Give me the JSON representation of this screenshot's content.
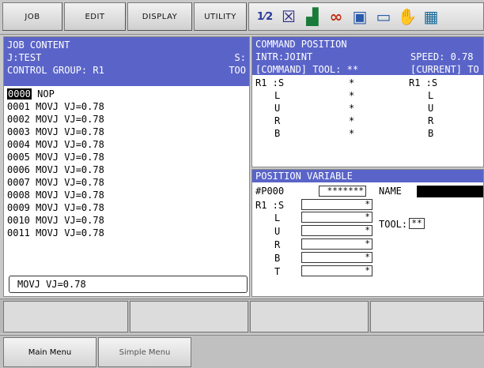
{
  "menu": {
    "job": "JOB",
    "edit": "EDIT",
    "display": "DISPLAY",
    "utility": "UTILITY"
  },
  "toolbar_icons": [
    {
      "name": "teach-mode-icon",
      "glyph": "1⁄2",
      "color": "#2a3a9a"
    },
    {
      "name": "edit-check-icon",
      "glyph": "☒",
      "color": "#2a2a8a"
    },
    {
      "name": "chart-icon",
      "glyph": "▟",
      "color": "#1a7a3a"
    },
    {
      "name": "link-icon",
      "glyph": "∞",
      "color": "#c0301a"
    },
    {
      "name": "memory-icon",
      "glyph": "▣",
      "color": "#2a5aaa"
    },
    {
      "name": "screen-icon",
      "glyph": "▭",
      "color": "#2a5aaa"
    },
    {
      "name": "hand-icon",
      "glyph": "✋",
      "color": "#d09000"
    },
    {
      "name": "grid-icon",
      "glyph": "▦",
      "color": "#1a6a9a"
    }
  ],
  "job_content": {
    "title": "JOB CONTENT",
    "job_name": "J:TEST",
    "step_label": "S:",
    "control_group": "CONTROL GROUP: R1",
    "tool_label": "TOO",
    "highlight_line_no": "0000",
    "highlight_line_text": "NOP",
    "lines": [
      "0001 MOVJ VJ=0.78",
      "0002 MOVJ VJ=0.78",
      "0003 MOVJ VJ=0.78",
      "0004 MOVJ VJ=0.78",
      "0005 MOVJ VJ=0.78",
      "0006 MOVJ VJ=0.78",
      "0007 MOVJ VJ=0.78",
      "0008 MOVJ VJ=0.78",
      "0009 MOVJ VJ=0.78",
      "0010 MOVJ VJ=0.78",
      "0011 MOVJ VJ=0.78"
    ],
    "edit_buffer": "MOVJ VJ=0.78"
  },
  "command_position": {
    "title": "COMMAND POSITION",
    "interp": "INTR:JOINT",
    "speed": "SPEED: 0.78",
    "command_tool": "[COMMAND] TOOL: **",
    "current_label": "[CURRENT] TO",
    "left_group": "R1 :S",
    "right_group": "R1 :S",
    "axes": [
      "L",
      "U",
      "R",
      "B"
    ],
    "value": "*"
  },
  "position_variable": {
    "title": "POSITION VARIABLE",
    "var_label": "#P000",
    "var_value": "*******",
    "name_label": "NAME",
    "group": "R1 :S",
    "axes": [
      "L",
      "U",
      "R",
      "B",
      "T"
    ],
    "value": "*",
    "tool_label": "TOOL:",
    "tool_value": "**"
  },
  "bottom": {
    "main_menu": "Main Menu",
    "simple_menu": "Simple Menu"
  }
}
